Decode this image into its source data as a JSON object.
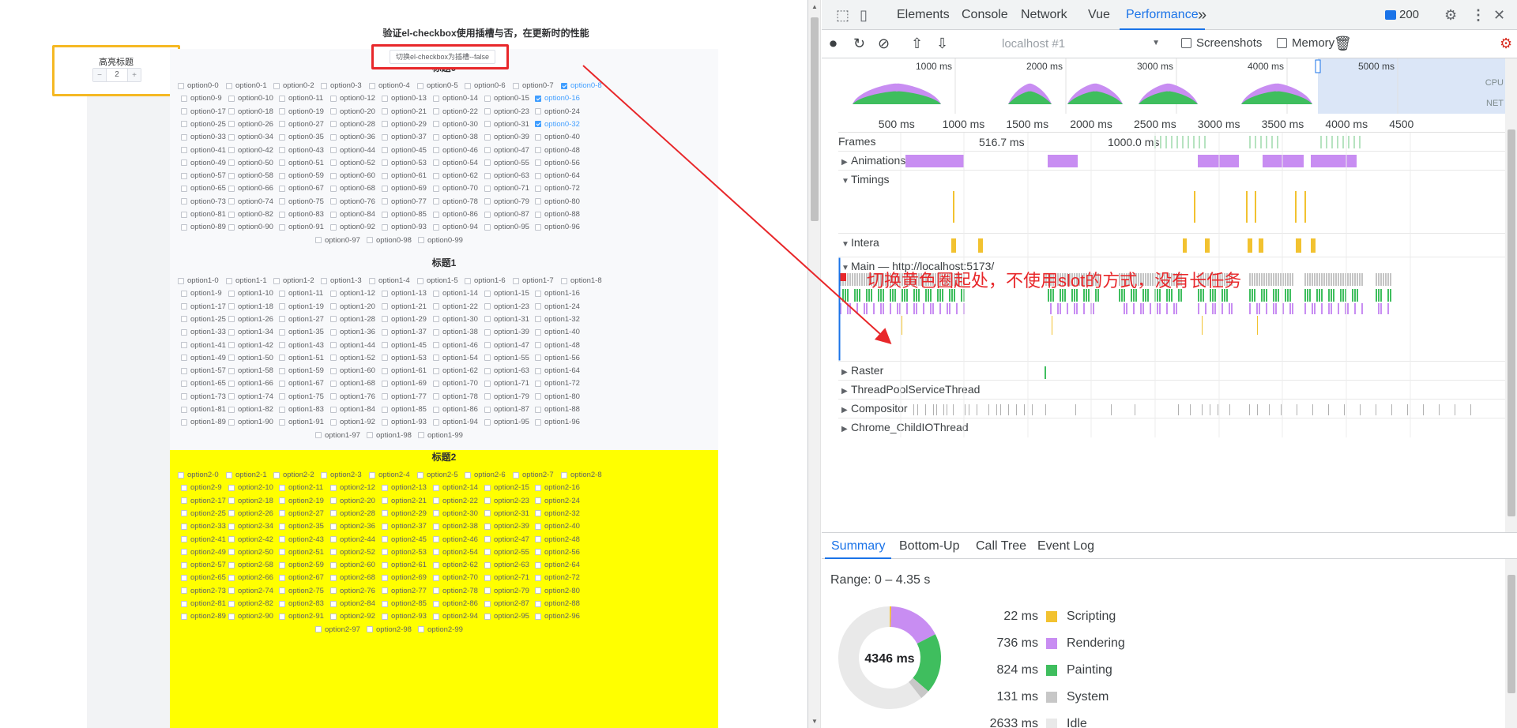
{
  "page": {
    "title": "验证el-checkbox使用插槽与否，在更新时的性能",
    "toggle_button": "切换el-checkbox为插槽--false",
    "side_panel": {
      "label": "高亮标题",
      "stepper_value": "2",
      "minus": "−",
      "plus": "+"
    },
    "groups": [
      {
        "title": "标题0",
        "prefix": "option0-",
        "checked": [
          8,
          16,
          32
        ],
        "highlight": false
      },
      {
        "title": "标题1",
        "prefix": "option1-",
        "checked": [],
        "highlight": false
      },
      {
        "title": "标题2",
        "prefix": "option2-",
        "checked": [],
        "highlight": true
      }
    ],
    "highlight_color": "#ffff00"
  },
  "devtools": {
    "tabs": [
      "Elements",
      "Console",
      "Network",
      "Vue",
      "Performance"
    ],
    "active_tab": "Performance",
    "more_tabs": "»",
    "issues_count": "200",
    "icons": {
      "inspect": "inspect-icon",
      "device": "device-toggle-icon",
      "settings": "gear-icon",
      "more": "kebab-menu-icon"
    },
    "toolbar": {
      "target": "localhost #1",
      "screenshots_label": "Screenshots",
      "memory_label": "Memory"
    },
    "overview_labels": [
      "1000 ms",
      "2000 ms",
      "3000 ms",
      "4000 ms",
      "5000 ms"
    ],
    "overview_side": [
      "CPU",
      "NET"
    ],
    "ruler_labels": [
      "500 ms",
      "1000 ms",
      "1500 ms",
      "2000 ms",
      "2500 ms",
      "3000 ms",
      "3500 ms",
      "4000 ms",
      "4500"
    ],
    "tracks": {
      "frames": "Frames",
      "frames_time1": "516.7 ms",
      "frames_time2": "1000.0 ms",
      "animations": "Animations",
      "timings": "Timings",
      "interactions": "Intera",
      "main": "Main — http://localhost:5173/",
      "raster": "Raster",
      "threadpool": "ThreadPoolServiceThread",
      "compositor": "Compositor",
      "childio": "Chrome_ChildIOThread"
    },
    "annotation": "切换黄色圈起处，不使用slot的方式，没有长任务",
    "bottom_tabs": [
      "Summary",
      "Bottom-Up",
      "Call Tree",
      "Event Log"
    ],
    "range": "Range: 0 – 4.35 s",
    "total": "4346 ms",
    "summary": [
      {
        "value": "22 ms",
        "name": "Scripting",
        "color": "#f2c230",
        "ms": 22
      },
      {
        "value": "736 ms",
        "name": "Rendering",
        "color": "#c88df2",
        "ms": 736
      },
      {
        "value": "824 ms",
        "name": "Painting",
        "color": "#3fbe5e",
        "ms": 824
      },
      {
        "value": "131 ms",
        "name": "System",
        "color": "#c7c7c7",
        "ms": 131
      },
      {
        "value": "2633 ms",
        "name": "Idle",
        "color": "#e9e9e9",
        "ms": 2633
      }
    ]
  }
}
